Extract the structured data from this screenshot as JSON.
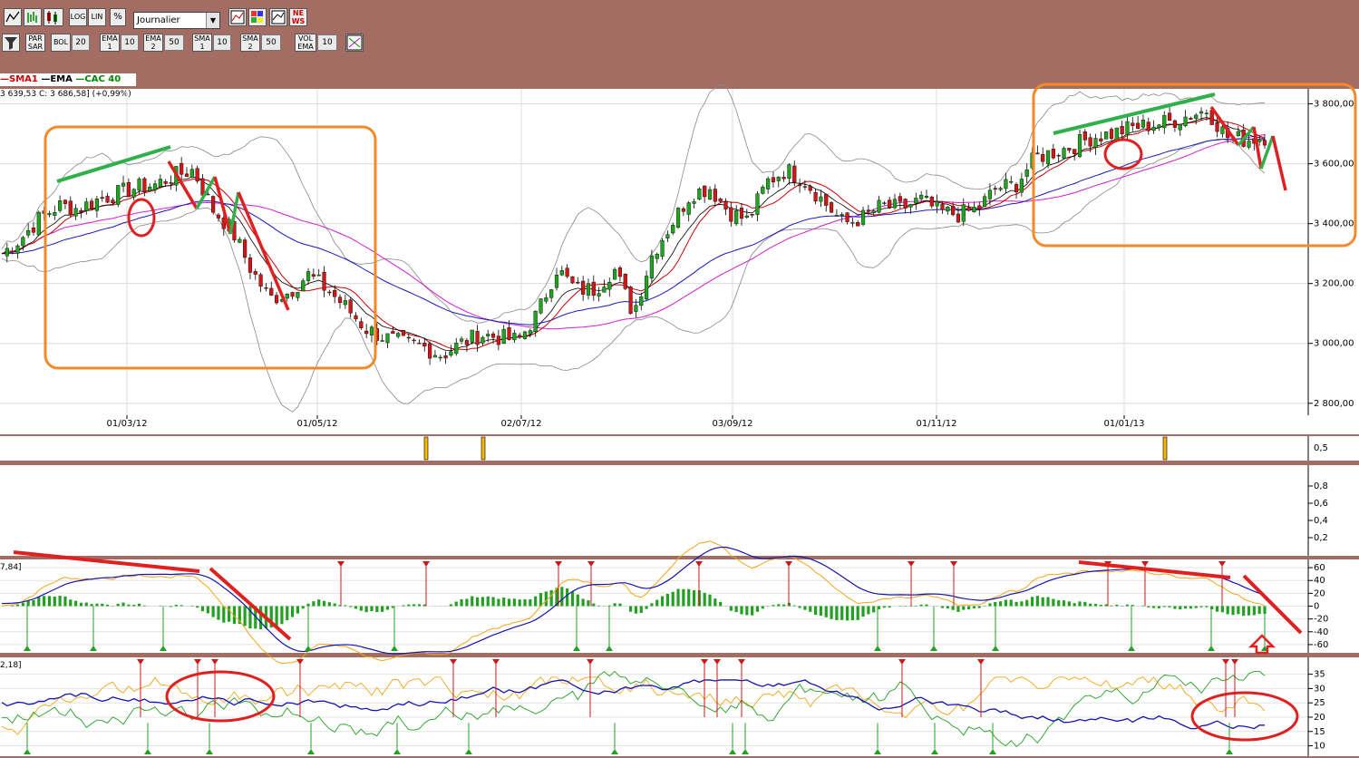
{
  "toolbar1": {
    "log": "LOG",
    "lin": "LIN",
    "pct": "%",
    "period": "Journalier",
    "news": "NE\nWS"
  },
  "toolbar2": {
    "parsar": "PAR\nSAR",
    "bol": "BOL",
    "bol_val": "20",
    "ema1": "EMA\n1",
    "ema1_val": "10",
    "ema2": "EMA\n2",
    "ema2_val": "50",
    "sma1": "SMA\n1",
    "sma1_val": "10",
    "sma2": "SMA\n2",
    "sma2_val": "50",
    "volema": "VOL\nEMA",
    "volema_val": "10"
  },
  "legend": {
    "sma1": "SMA1",
    "ema": "EMA",
    "cac": "CAC 40"
  },
  "quote": "3 639,53  C: 3 686,58] (+0,99%)",
  "osc1_label": "7,84]",
  "osc2_label": "2,18]",
  "colors": {
    "chrome": "#a46d64",
    "up": "#1fa51f",
    "down": "#d11717",
    "ema_long": "#1a1ab8",
    "sma_long": "#d21ed2",
    "orange": "#f28a2a",
    "annot_red": "#e02020",
    "annot_green": "#2fb04a"
  },
  "chart_data": [
    {
      "type": "candlestick",
      "title": "CAC 40",
      "x_tick_labels": [
        "01/03/12",
        "01/05/12",
        "02/07/12",
        "03/09/12",
        "01/11/12",
        "01/01/13"
      ],
      "y_tick_labels": [
        "3 800,00",
        "3 600,00",
        "3 400,00",
        "3 200,00",
        "3 000,00",
        "2 800,00"
      ],
      "ylim": [
        2760,
        3850
      ],
      "series": [
        {
          "name": "SMA1"
        },
        {
          "name": "EMA"
        },
        {
          "name": "CAC 40"
        }
      ],
      "close_approx": [
        3300,
        3350,
        3420,
        3460,
        3450,
        3480,
        3500,
        3520,
        3530,
        3560,
        3580,
        3450,
        3380,
        3250,
        3150,
        3170,
        3230,
        3180,
        3120,
        3050,
        3020,
        3000,
        2990,
        2960,
        3000,
        3030,
        3020,
        3010,
        3100,
        3250,
        3180,
        3180,
        3250,
        3100,
        3300,
        3400,
        3500,
        3520,
        3440,
        3410,
        3540,
        3580,
        3540,
        3470,
        3400,
        3420,
        3460,
        3450,
        3480,
        3440,
        3430,
        3450,
        3520,
        3530,
        3620,
        3640,
        3660,
        3690,
        3700,
        3720,
        3730,
        3740,
        3760,
        3780,
        3690,
        3680,
        3690
      ]
    },
    {
      "type": "bar",
      "y_tick_labels": [
        "0,5"
      ],
      "markers": [
        {
          "x": "near 12/06/12"
        },
        {
          "x": "near 28/06/12"
        },
        {
          "x": "near 26/12/12"
        }
      ]
    },
    {
      "type": "line",
      "y_tick_labels": [
        "0,8",
        "0,6",
        "0,4",
        "0,2"
      ]
    },
    {
      "type": "line",
      "y_tick_labels": [
        "60",
        "40",
        "20",
        "0",
        "-20",
        "-40",
        "-60"
      ],
      "ylim": [
        -70,
        70
      ]
    },
    {
      "type": "line",
      "y_tick_labels": [
        "35",
        "30",
        "25",
        "20",
        "15",
        "10"
      ],
      "ylim": [
        7,
        39
      ]
    }
  ]
}
